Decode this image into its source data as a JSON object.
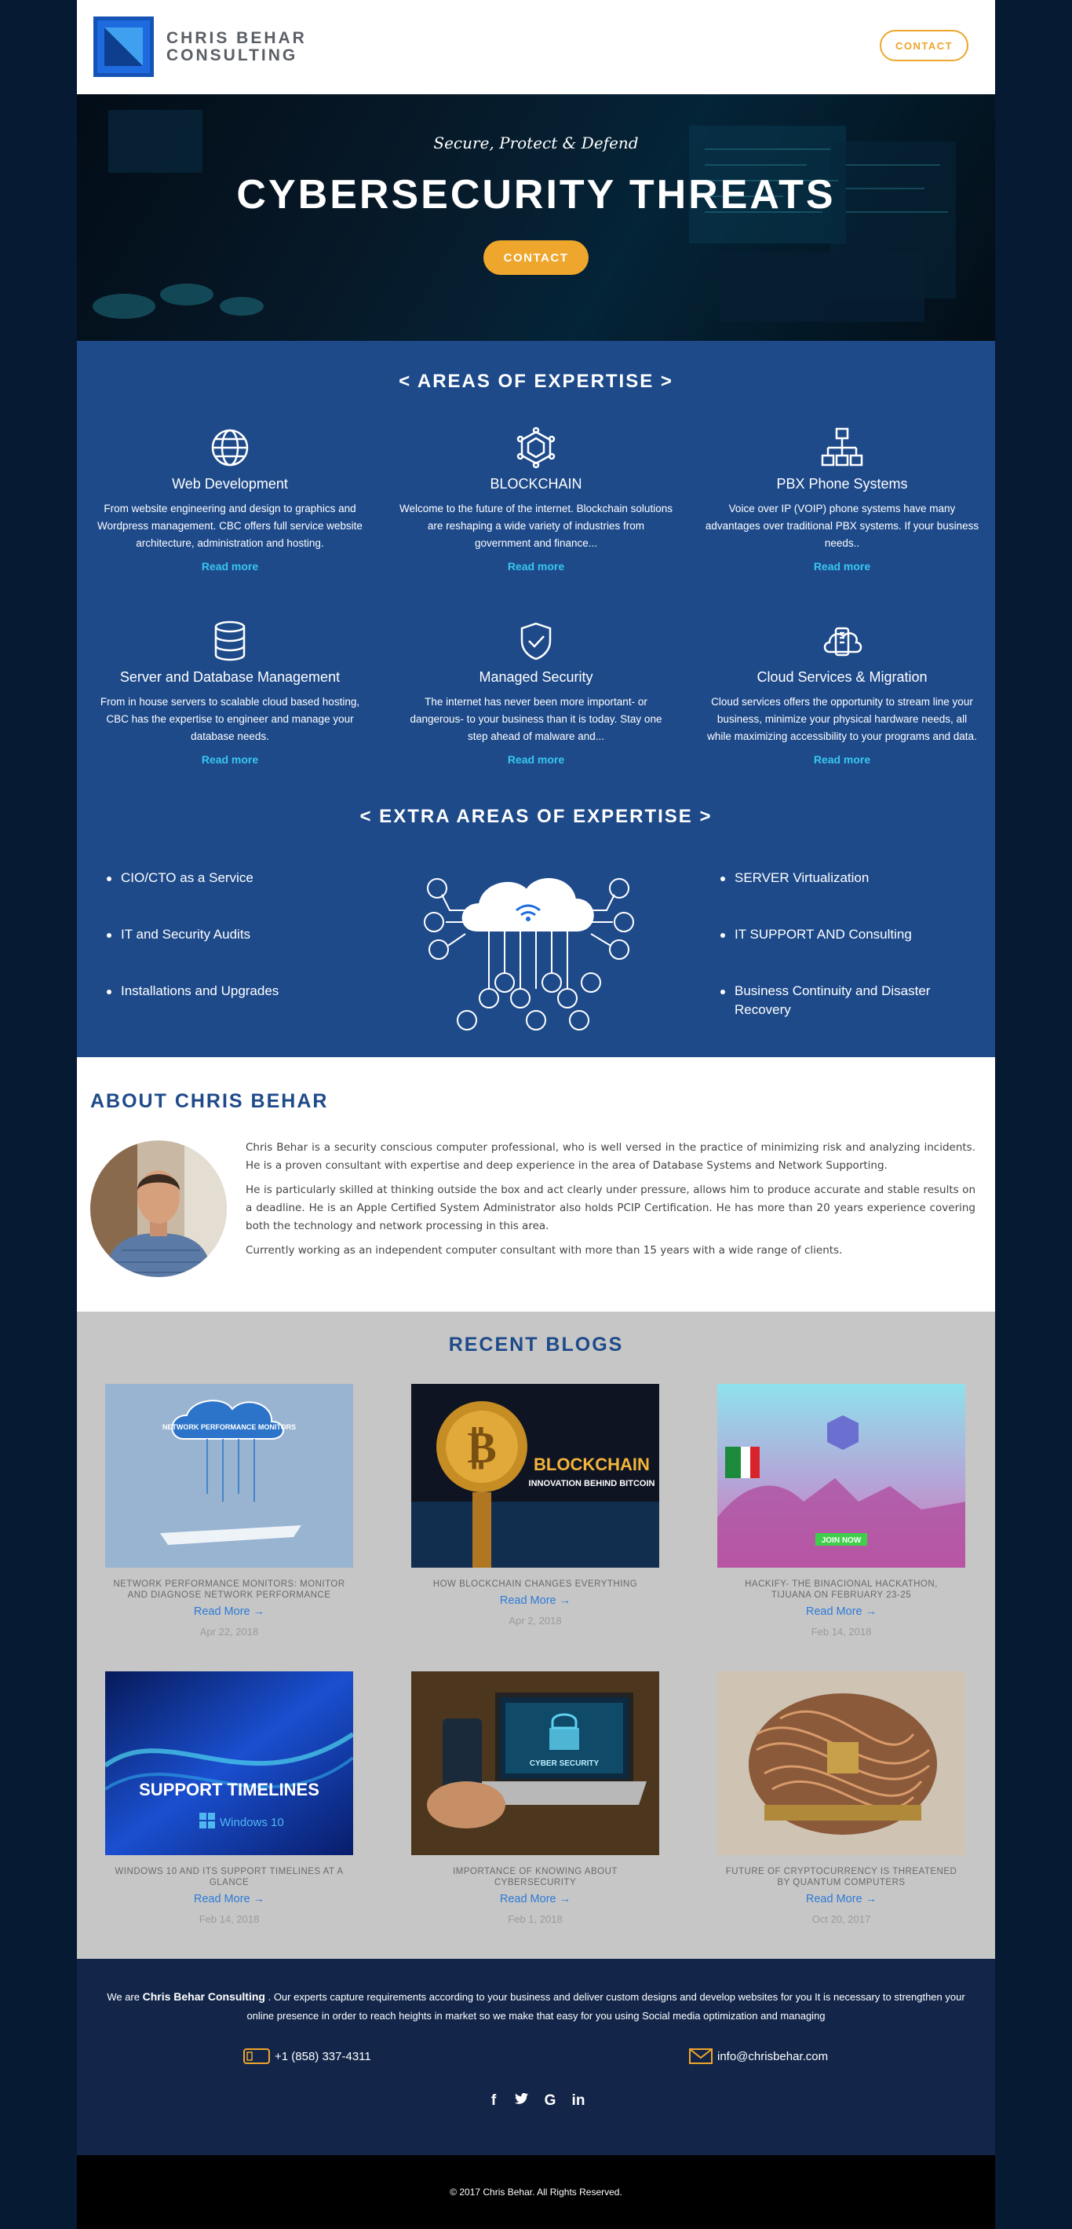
{
  "brand": {
    "name_line1": "CHRIS BEHAR",
    "name_line2": "CONSULTING"
  },
  "header": {
    "contact_label": "CONTACT"
  },
  "hero": {
    "tagline": "Secure, Protect & Defend",
    "title": "CYBERSECURITY THREATS",
    "cta_label": "CONTACT"
  },
  "expertise": {
    "title": "< AREAS OF EXPERTISE >",
    "cards": [
      {
        "title": "Web Development",
        "text": "From website engineering and design to graphics and Wordpress management. CBC offers full service website architecture, administration and hosting.",
        "link": "Read more",
        "icon": "globe-icon"
      },
      {
        "title": "BLOCKCHAIN",
        "text": "Welcome to the future of the internet. Blockchain solutions are reshaping a wide variety of industries from government and finance...",
        "link": "Read more",
        "icon": "blockchain-icon"
      },
      {
        "title": "PBX Phone Systems",
        "text": "Voice over IP (VOIP) phone systems have many advantages over traditional PBX systems. If your business needs..",
        "link": "Read more",
        "icon": "network-tree-icon"
      },
      {
        "title": "Server and Database Management",
        "text": "From in house servers to scalable cloud based hosting, CBC has the expertise to engineer and manage your database needs.",
        "link": "Read more",
        "icon": "database-icon"
      },
      {
        "title": "Managed Security",
        "text": "The internet has never been more important- or dangerous- to your business than it is today. Stay one step ahead of malware and...",
        "link": "Read more",
        "icon": "shield-check-icon"
      },
      {
        "title": "Cloud Services & Migration",
        "text": "Cloud services offers the opportunity to stream line your business, minimize your physical hardware needs, all while maximizing accessibility to your programs and data.",
        "link": "Read more",
        "icon": "cloud-device-icon"
      }
    ]
  },
  "extra": {
    "title": "< EXTRA AREAS OF EXPERTISE >",
    "left": [
      "CIO/CTO as a Service",
      "IT and Security Audits",
      "Installations and Upgrades"
    ],
    "right": [
      "SERVER Virtualization",
      "IT SUPPORT AND Consulting",
      "Business Continuity and Disaster Recovery"
    ]
  },
  "about": {
    "title": "ABOUT CHRIS BEHAR",
    "paragraphs": [
      "Chris Behar is a security conscious computer professional, who is well versed in the practice of minimizing risk and analyzing incidents. He is a proven consultant with expertise and deep experience in the area of Database Systems and Network Supporting.",
      "He is particularly skilled at thinking outside the box and act clearly under pressure, allows him to produce accurate and stable results on a deadline. He is an Apple Certified System Administrator also holds PCIP Certification. He has more than 20 years experience covering both the technology and network processing in this area.",
      "Currently working as an independent computer consultant with more than 15 years with a wide range of clients."
    ]
  },
  "blogs": {
    "title": "RECENT BLOGS",
    "posts": [
      {
        "title": "NETWORK PERFORMANCE MONITORS: MONITOR AND DIAGNOSE NETWORK PERFORMANCE",
        "more": "Read More →",
        "date": "Apr 22, 2018",
        "thumb_text": "NETWORK PERFORMANCE MONITORS"
      },
      {
        "title": "HOW BLOCKCHAIN CHANGES EVERYTHING",
        "more": "Read More →",
        "date": "Apr 2, 2018",
        "thumb_text": "BLOCKCHAIN",
        "thumb_sub": "INNOVATION BEHIND BITCOIN"
      },
      {
        "title": "HACKIFY- THE BINACIONAL HACKATHON, TIJUANA ON FEBRUARY 23-25",
        "more": "Read More →",
        "date": "Feb 14, 2018",
        "thumb_text": "JOIN NOW"
      },
      {
        "title": "WINDOWS 10 AND ITS SUPPORT TIMELINES AT A GLANCE",
        "more": "Read More →",
        "date": "Feb 14, 2018",
        "thumb_text": "SUPPORT TIMELINES",
        "thumb_sub": "Windows 10"
      },
      {
        "title": "IMPORTANCE OF KNOWING ABOUT CYBERSECURITY",
        "more": "Read More →",
        "date": "Feb 1, 2018",
        "thumb_text": "CYBER SECURITY"
      },
      {
        "title": "FUTURE OF CRYPTOCURRENCY IS THREATENED BY QUANTUM COMPUTERS",
        "more": "Read More →",
        "date": "Oct 20, 2017"
      }
    ]
  },
  "footer": {
    "intro_prefix": "We are",
    "intro_brand": "Chris Behar Consulting",
    "intro_rest": ". Our experts capture requirements according to your business and deliver custom designs and develop websites for you It is necessary to strengthen your online presence in order to reach heights in market so we make that easy for you using Social media optimization and managing",
    "phone": "+1 (858) 337-4311",
    "email": "info@chrisbehar.com",
    "social": [
      "facebook-icon",
      "twitter-icon",
      "google-icon",
      "linkedin-icon"
    ],
    "copyright": "© 2017 Chris Behar. All Rights Reserved."
  },
  "colors": {
    "brand_blue": "#1e4a8a",
    "accent_orange": "#eea62c",
    "link_cyan": "#38c6f2",
    "footer_navy": "#13264a"
  }
}
